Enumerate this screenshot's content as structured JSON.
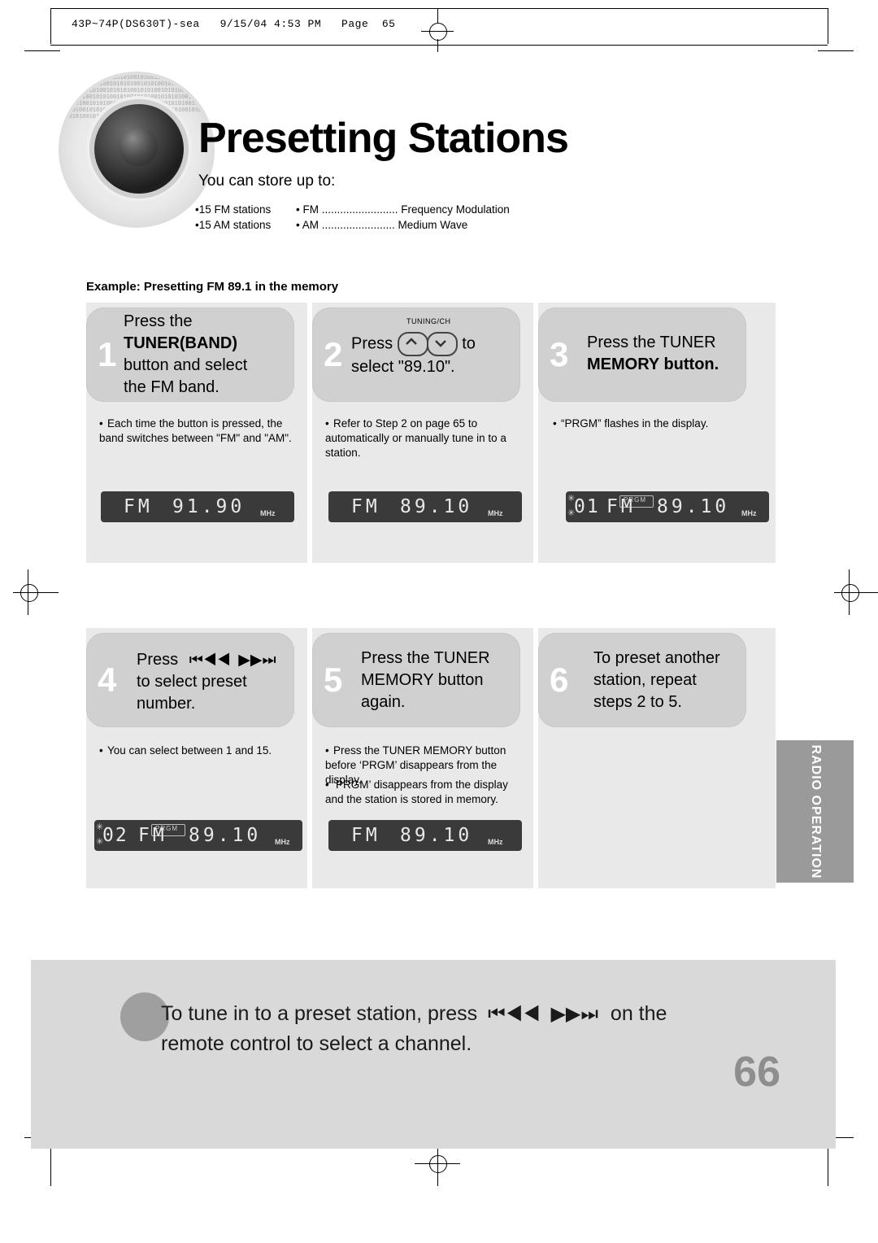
{
  "print": {
    "file_stamp": "43P~74P(DS630T)-sea   9/15/04 4:53 PM   Page  65"
  },
  "header": {
    "title": "Presetting Stations",
    "intro": "You can store up to:",
    "bullets_left": [
      "•15 FM stations",
      "•15 AM stations"
    ],
    "bullets_right": [
      "• FM ......................... Frequency Modulation",
      "• AM ........................ Medium Wave"
    ],
    "example": "Example: Presetting FM 89.1 in the memory"
  },
  "steps": [
    {
      "num": "1",
      "line1": "Press the",
      "line2": "TUNER(BAND)",
      "line3": "button  and select",
      "line4": "the FM band.",
      "notes": [
        "Each time the button is pressed, the band switches between \"FM\" and \"AM\"."
      ],
      "lcd": {
        "freq": "91.90",
        "band": "FM",
        "unit": "MHz",
        "prgm": "",
        "preset": ""
      }
    },
    {
      "num": "2",
      "line1": "Press",
      "line2": "to",
      "line3": "select \"89.10\".",
      "knob_label": "TUNING/CH",
      "notes": [
        "Refer to Step 2 on page 65 to automatically or manually tune in to a station."
      ],
      "lcd": {
        "freq": "89.10",
        "band": "FM",
        "unit": "MHz",
        "prgm": "",
        "preset": ""
      }
    },
    {
      "num": "3",
      "line1": "Press the TUNER",
      "line2": "MEMORY button.",
      "notes": [
        "“PRGM” flashes in the display."
      ],
      "lcd": {
        "freq": "89.10",
        "band": "FM",
        "unit": "MHz",
        "prgm": "PRGM",
        "preset": "01"
      }
    },
    {
      "num": "4",
      "line1": "Press",
      "line2": "to select preset",
      "line3": "number.",
      "notes": [
        "You can select between 1 and 15."
      ],
      "lcd": {
        "freq": "89.10",
        "band": "FM",
        "unit": "MHz",
        "prgm": "PRGM",
        "preset": "02"
      }
    },
    {
      "num": "5",
      "line1": "Press the TUNER",
      "line2": "MEMORY button",
      "line3": "again.",
      "notes": [
        "Press the TUNER MEMORY button before ‘PRGM’ disappears from the display.",
        "‘PRGM’ disappears from the display and the station is stored in memory."
      ],
      "lcd": {
        "freq": "89.10",
        "band": "FM",
        "unit": "MHz",
        "prgm": "",
        "preset": ""
      }
    },
    {
      "num": "6",
      "line1": "To preset another",
      "line2": "station, repeat",
      "line3": "steps 2 to 5.",
      "notes": [],
      "lcd": null
    }
  ],
  "side_tab": {
    "label": "RADIO OPERATION"
  },
  "banner": {
    "line1_a": "To tune in to a preset station, press",
    "line1_b": "on the",
    "line2": "remote control to select a channel.",
    "skip_icon": "skip-back-forward-icon"
  },
  "page_number": "66",
  "icons": {
    "knob_up": "tuning-up-knob-icon",
    "knob_down": "tuning-down-knob-icon",
    "skip_back": "skip-back-icon",
    "skip_forward": "skip-forward-icon"
  },
  "colors": {
    "panel": "#e9e9e9",
    "step_box": "#d0d0d0",
    "lcd_bg": "#3a3a3a",
    "lcd_text": "#e8e8e8",
    "side_tab": "#9a9a9a",
    "banner": "#d9d9d9",
    "page_number": "#8e8e8e"
  }
}
